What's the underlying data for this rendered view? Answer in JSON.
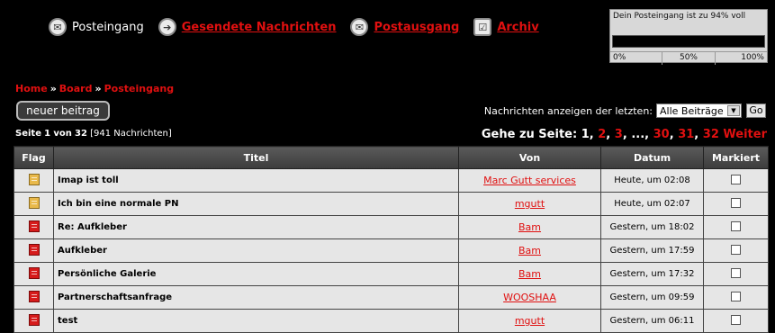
{
  "nav": {
    "items": [
      {
        "label": "Posteingang",
        "icon": "inbox-icon"
      },
      {
        "label": "Gesendete Nachrichten",
        "icon": "sent-icon"
      },
      {
        "label": "Postausgang",
        "icon": "outbox-icon"
      },
      {
        "label": "Archiv",
        "icon": "archive-icon"
      }
    ]
  },
  "quota": {
    "text": "Dein Posteingang ist zu 94% voll",
    "fill_percent": 94,
    "scale_0": "0%",
    "scale_50": "50%",
    "scale_100": "100%"
  },
  "breadcrumb": {
    "home": "Home",
    "sep1": "»",
    "board": "Board",
    "sep2": "»",
    "current": "Posteingang"
  },
  "actions": {
    "new_post": "neuer beitrag"
  },
  "filter": {
    "label": "Nachrichten anzeigen der letzten:",
    "selected": "Alle Beiträge",
    "go": "Go"
  },
  "paging": {
    "page_label": "Seite",
    "page_current": "1",
    "of_label": "von",
    "page_total": "32",
    "count_text": "[941 Nachrichten]",
    "goto_label": "Gehe zu Seite:",
    "p1": "1",
    "p2": "2",
    "p3": "3",
    "ellipsis": "...",
    "p30": "30",
    "p31": "31",
    "p32": "32",
    "next": "Weiter"
  },
  "table": {
    "headers": {
      "flag": "Flag",
      "title": "Titel",
      "from": "Von",
      "date": "Datum",
      "marked": "Markiert"
    },
    "rows": [
      {
        "flag": "read",
        "title": "Imap ist toll",
        "from": "Marc Gutt services",
        "date": "Heute, um 02:08"
      },
      {
        "flag": "read",
        "title": "Ich bin eine normale PN",
        "from": "mgutt",
        "date": "Heute, um 02:07"
      },
      {
        "flag": "unread",
        "title": "Re: Aufkleber",
        "from": "Bam",
        "date": "Gestern, um 18:02"
      },
      {
        "flag": "unread",
        "title": "Aufkleber",
        "from": "Bam",
        "date": "Gestern, um 17:59"
      },
      {
        "flag": "unread",
        "title": "Persönliche Galerie",
        "from": "Bam",
        "date": "Gestern, um 17:32"
      },
      {
        "flag": "unread",
        "title": "Partnerschaftsanfrage",
        "from": "WOOSHAA",
        "date": "Gestern, um 09:59"
      },
      {
        "flag": "unread",
        "title": "test",
        "from": "mgutt",
        "date": "Gestern, um 06:11"
      }
    ]
  },
  "colors": {
    "accent": "#e01010",
    "background": "#000000",
    "row": "#e6e6e6"
  }
}
